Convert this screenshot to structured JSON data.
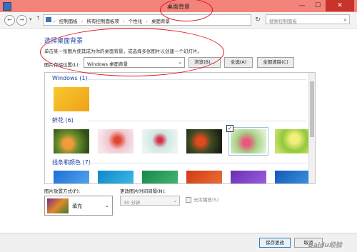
{
  "window": {
    "title": "桌面背景"
  },
  "address": {
    "crumbs": [
      "控制面板",
      "所有控制面板项",
      "个性化",
      "桌面背景"
    ],
    "search_placeholder": "搜索控制面板"
  },
  "main": {
    "heading": "选择桌面背景",
    "subtitle": "单击某一张图片使其成为你的桌面背景，或选择多张图片以创建一个幻灯片。",
    "location_label": "图片存储位置(L):",
    "location_value": "Windows 桌面背景",
    "browse_label": "浏览(B)...",
    "select_all_label": "全选(A)",
    "clear_all_label": "全部清除(C)"
  },
  "gallery": {
    "groups": [
      {
        "name": "Windows (1)"
      },
      {
        "name": "鲜花 (6)"
      },
      {
        "name": "线条和颜色 (7)"
      }
    ]
  },
  "options": {
    "position_label": "图片放置方式(P):",
    "position_value": "填充",
    "interval_label": "更改图片时间间隔(N):",
    "interval_value": "30 分钟",
    "shuffle_label": "无序播放(S)"
  },
  "footer": {
    "save_label": "保存更改",
    "cancel_label": "取消"
  },
  "watermark": "Baidu经验",
  "colors": {
    "titlebar": "#f3837b",
    "heading": "#1e3d9e",
    "close": "#c8342c"
  }
}
